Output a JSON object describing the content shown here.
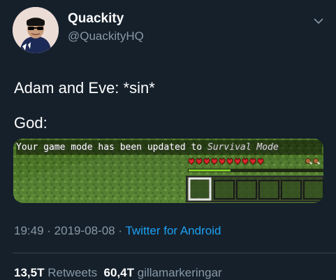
{
  "user": {
    "display_name": "Quackity",
    "handle": "@QuackityHQ"
  },
  "tweet": {
    "lines": [
      "Adam and Eve: *sin*",
      "God:"
    ],
    "game_message": {
      "prefix": "Your game mode has been updated to ",
      "mode": "Survival Mode"
    },
    "hearts_visible": 10,
    "hotbar_slots_visible": 6
  },
  "meta": {
    "time": "19:49",
    "date": "2019-08-08",
    "separator": " · ",
    "client": "Twitter for Android"
  },
  "stats": {
    "retweets_count": "13,5T",
    "retweets_label": "Retweets",
    "likes_count": "60,4T",
    "likes_label": "gillamarkeringar"
  },
  "colors": {
    "background": "#15202b",
    "secondary_text": "#8899a6",
    "link": "#1da1f2",
    "divider": "#38444d"
  },
  "icons": {
    "menu": "chevron-down-icon",
    "heart": "minecraft-heart-icon"
  }
}
